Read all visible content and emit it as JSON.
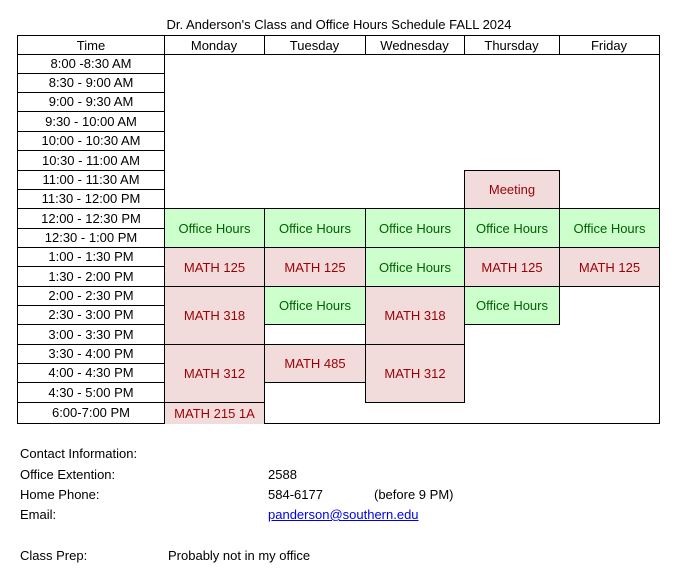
{
  "title": "Dr. Anderson's Class and Office Hours Schedule FALL 2024",
  "headers": [
    "Time",
    "Monday",
    "Tuesday",
    "Wednesday",
    "Thursday",
    "Friday"
  ],
  "time_slots": [
    "8:00 -8:30 AM",
    "8:30 - 9:00 AM",
    "9:00 - 9:30 AM",
    "9:30 - 10:00 AM",
    "10:00 - 10:30 AM",
    "10:30 - 11:00 AM",
    "11:00 - 11:30 AM",
    "11:30 - 12:00 PM",
    "12:00 - 12:30 PM",
    "12:30 - 1:00 PM",
    "1:00 - 1:30 PM",
    "1:30 - 2:00 PM",
    "2:00 - 2:30 PM",
    "2:30 - 3:00 PM",
    "3:00 - 3:30 PM",
    "3:30 - 4:00 PM",
    "4:00 - 4:30 PM",
    "4:30 - 5:00 PM",
    "6:00-7:00 PM"
  ],
  "events": {
    "thu_meeting": {
      "day": "Thursday",
      "label": "Meeting",
      "type": "class",
      "slots": "11:00 - 12:00 PM"
    },
    "mon_oh_noon": {
      "day": "Monday",
      "label": "Office Hours",
      "type": "office-hours"
    },
    "tue_oh_noon": {
      "day": "Tuesday",
      "label": "Office Hours",
      "type": "office-hours"
    },
    "wed_oh_noon": {
      "day": "Wednesday",
      "label": "Office Hours",
      "type": "office-hours"
    },
    "thu_oh_noon": {
      "day": "Thursday",
      "label": "Office Hours",
      "type": "office-hours"
    },
    "fri_oh_noon": {
      "day": "Friday",
      "label": "Office Hours",
      "type": "office-hours"
    },
    "mon_125": {
      "day": "Monday",
      "label": "MATH 125",
      "type": "class"
    },
    "tue_125": {
      "day": "Tuesday",
      "label": "MATH 125",
      "type": "class"
    },
    "wed_oh_1": {
      "day": "Wednesday",
      "label": "Office Hours",
      "type": "office-hours"
    },
    "thu_125": {
      "day": "Thursday",
      "label": "MATH 125",
      "type": "class"
    },
    "fri_125": {
      "day": "Friday",
      "label": "MATH 125",
      "type": "class"
    },
    "mon_318": {
      "day": "Monday",
      "label": "MATH 318",
      "type": "class"
    },
    "tue_oh_2": {
      "day": "Tuesday",
      "label": "Office Hours",
      "type": "office-hours"
    },
    "wed_318": {
      "day": "Wednesday",
      "label": "MATH 318",
      "type": "class"
    },
    "thu_oh_2": {
      "day": "Thursday",
      "label": "Office Hours",
      "type": "office-hours"
    },
    "mon_312": {
      "day": "Monday",
      "label": "MATH 312",
      "type": "class"
    },
    "tue_485": {
      "day": "Tuesday",
      "label": "MATH 485",
      "type": "class"
    },
    "wed_312": {
      "day": "Wednesday",
      "label": "MATH 312",
      "type": "class"
    },
    "mon_215": {
      "day": "Monday",
      "label": "MATH 215 1A",
      "type": "class"
    }
  },
  "contact": {
    "heading": "Contact Information:",
    "office_ext_label": "Office Extention:",
    "office_ext_value": "2588",
    "home_phone_label": "Home Phone:",
    "home_phone_value": "584-6177",
    "home_phone_note": "(before 9 PM)",
    "email_label": "Email:",
    "email_value": "panderson@southern.edu",
    "class_prep_label": "Class Prep:",
    "class_prep_value": "Probably not in my office"
  },
  "colors": {
    "class_bg": "#f2dcdb",
    "class_text": "#9c0006",
    "office_hours_bg": "#ccffcc",
    "office_hours_text": "#006100",
    "link": "#0000ee"
  }
}
